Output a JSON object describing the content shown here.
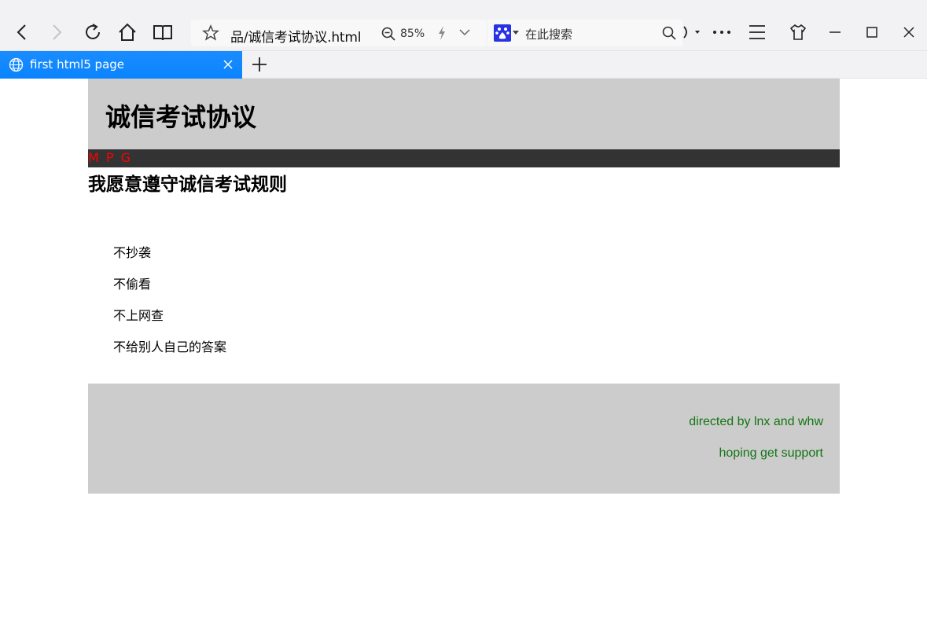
{
  "browser": {
    "address_url": "品/诚信考试协议.html",
    "zoom_level": "85%",
    "search_placeholder": "在此搜索",
    "tab_title": "first html5 page"
  },
  "page": {
    "title": "诚信考试协议",
    "nav_text": "M P G",
    "section_heading": "我愿意遵守诚信考试规则",
    "rules": [
      "不抄袭",
      "不偷看",
      "不上网查",
      "不给别人自己的答案"
    ],
    "footer_lines": [
      "directed by lnx and whw",
      "hoping get support"
    ]
  },
  "colors": {
    "header_bg": "#cccccc",
    "nav_bg": "#333333",
    "nav_text": "#ff0000",
    "footer_text": "#127512",
    "tab_active": "#0a84ff"
  }
}
